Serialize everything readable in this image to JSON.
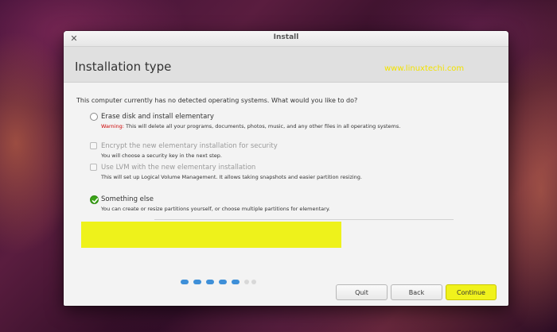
{
  "window": {
    "title": "Install"
  },
  "header": {
    "title": "Installation type",
    "watermark": "www.linuxtechi.com"
  },
  "question": "This computer currently has no detected operating systems. What would you like to do?",
  "options": [
    {
      "label": "Erase disk and install elementary",
      "warning_prefix": "Warning:",
      "description": "This will delete all your programs, documents, photos, music, and any other files in all operating systems.",
      "type": "radio",
      "checked": false,
      "enabled": true
    },
    {
      "label": "Encrypt the new elementary installation for security",
      "description": "You will choose a security key in the next step.",
      "type": "checkbox",
      "checked": false,
      "enabled": false
    },
    {
      "label": "Use LVM with the new elementary installation",
      "description": "This will set up Logical Volume Management. It allows taking snapshots and easier partition resizing.",
      "type": "checkbox",
      "checked": false,
      "enabled": false
    },
    {
      "label": "Something else",
      "description": "You can create or resize partitions yourself, or choose multiple partitions for elementary.",
      "type": "radio",
      "checked": true,
      "enabled": true
    }
  ],
  "buttons": {
    "quit": "Quit",
    "back": "Back",
    "continue": "Continue"
  },
  "progress": {
    "completed_steps": 5,
    "total_steps": 7
  },
  "colors": {
    "highlight": "#eef21b",
    "accent_green": "#3aa317",
    "warning_red": "#cc0000",
    "progress_blue": "#3e8fd8"
  }
}
